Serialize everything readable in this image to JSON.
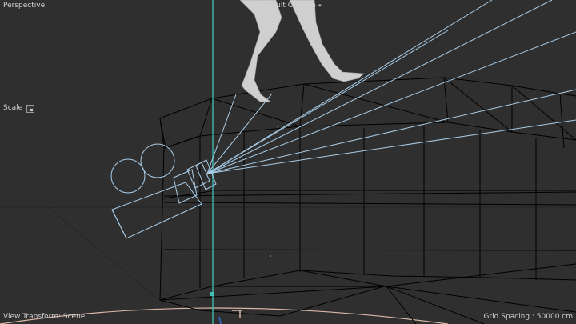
{
  "viewport": {
    "view_name": "Perspective",
    "camera_label": "Default Camera",
    "camera_chevron_icon": "chevron-down-icon",
    "scale_label": "Scale",
    "scale_icon": "scale-toggle-icon",
    "view_transform": "View Transform: Scene",
    "grid_spacing": "Grid Spacing : 50000 cm"
  },
  "colors": {
    "background": "#2f2f2f",
    "wireframe": "#000000",
    "camera_lines": "#a9cde8",
    "axis_green": "#3fc2b4",
    "floor_circle": "#d9b6a6",
    "figure": "#cfcfcf"
  }
}
